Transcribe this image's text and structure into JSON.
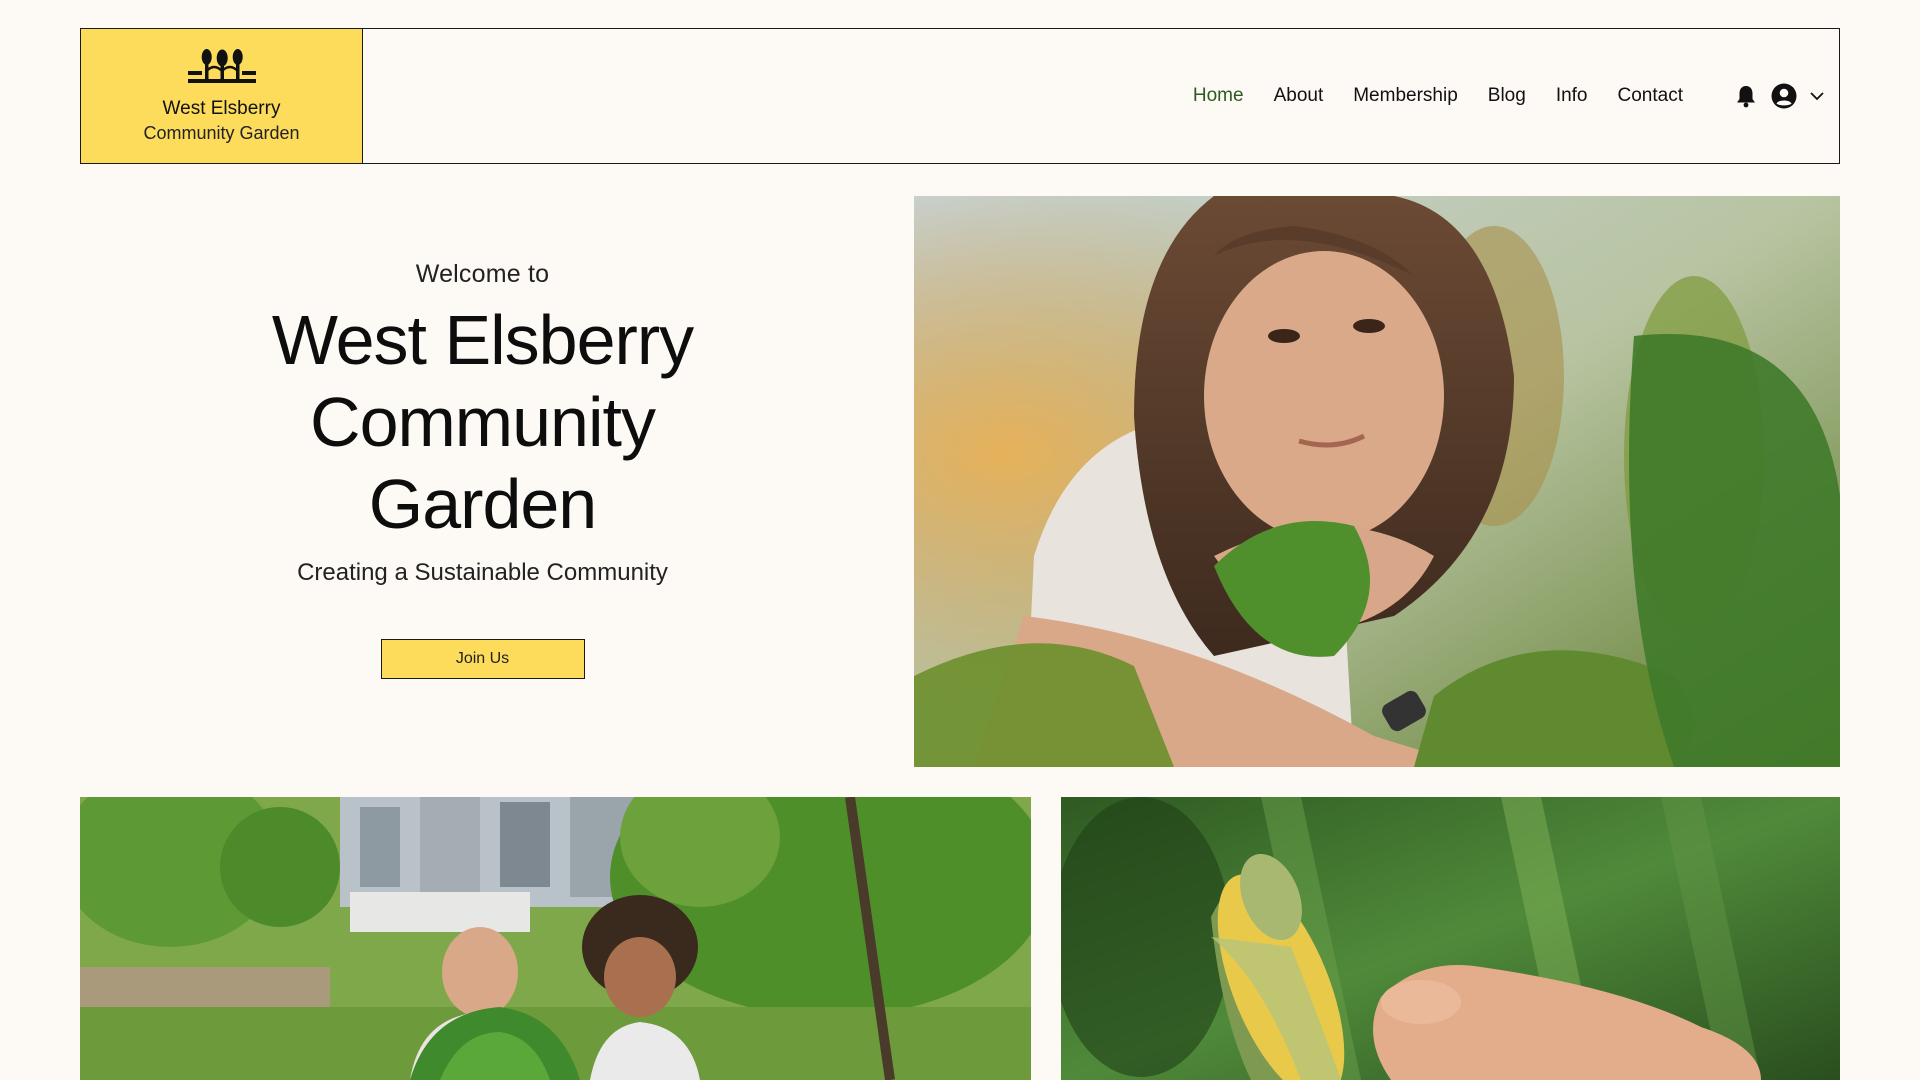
{
  "site": {
    "logo_line1": "West Elsberry",
    "logo_line2": "Community Garden"
  },
  "nav": {
    "items": [
      {
        "label": "Home",
        "active": true
      },
      {
        "label": "About",
        "active": false
      },
      {
        "label": "Membership",
        "active": false
      },
      {
        "label": "Blog",
        "active": false
      },
      {
        "label": "Info",
        "active": false
      },
      {
        "label": "Contact",
        "active": false
      }
    ]
  },
  "user": {
    "icons": [
      "bell-icon",
      "avatar-icon",
      "chevron-down-icon"
    ]
  },
  "hero": {
    "welcome": "Welcome to",
    "title": "West Elsberry Community Garden",
    "subtitle": "Creating a Sustainable Community",
    "button_label": "Join Us"
  },
  "colors": {
    "background": "#fdf9f5",
    "accent_yellow": "#fddc5c",
    "active_nav": "#2f5a1f",
    "border": "#1a1a1a"
  }
}
